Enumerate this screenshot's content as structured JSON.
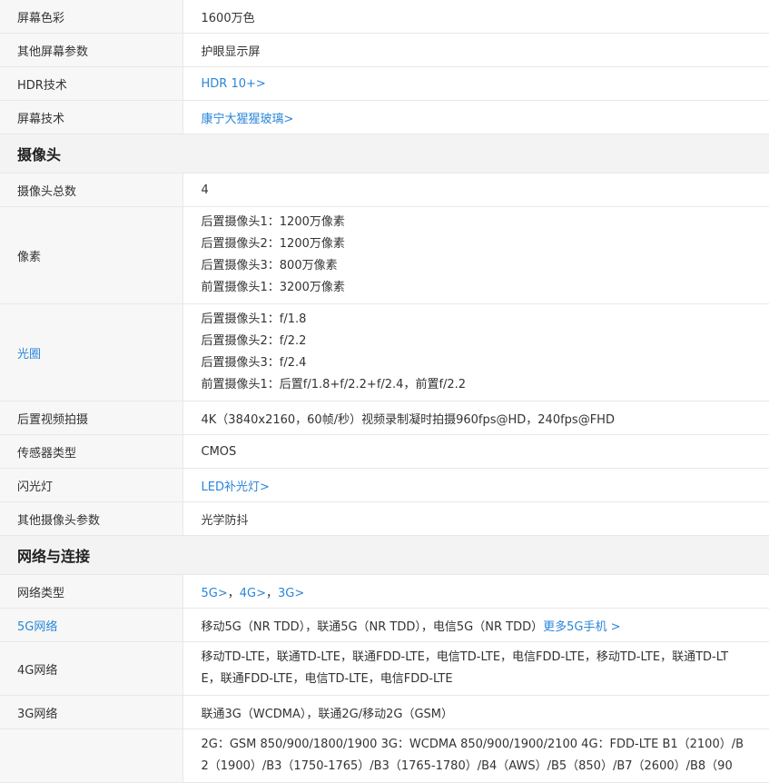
{
  "screen_rows": [
    {
      "label": "屏幕色彩",
      "value": "1600万色"
    },
    {
      "label": "其他屏幕参数",
      "value": "护眼显示屏"
    },
    {
      "label": "HDR技术",
      "value": "HDR 10+>"
    },
    {
      "label": "屏幕技术",
      "value": "康宁大猩猩玻璃>"
    }
  ],
  "camera": {
    "title": "摄像头",
    "total": {
      "label": "摄像头总数",
      "value": "4"
    },
    "pixels": {
      "label": "像素",
      "lines": [
        "后置摄像头1：1200万像素",
        "后置摄像头2：1200万像素",
        "后置摄像头3：800万像素",
        "前置摄像头1：3200万像素"
      ]
    },
    "aperture": {
      "label": "光圈",
      "lines": [
        "后置摄像头1：f/1.8",
        "后置摄像头2：f/2.2",
        "后置摄像头3：f/2.4",
        "前置摄像头1：后置f/1.8+f/2.2+f/2.4，前置f/2.2"
      ]
    },
    "video": {
      "label": "后置视频拍摄",
      "value": "4K（3840x2160，60帧/秒）视频录制凝时拍摄960fps@HD，240fps@FHD"
    },
    "sensor": {
      "label": "传感器类型",
      "value": "CMOS"
    },
    "flash": {
      "label": "闪光灯",
      "value": "LED补光灯>"
    },
    "other": {
      "label": "其他摄像头参数",
      "value": "光学防抖"
    }
  },
  "network": {
    "title": "网络与连接",
    "type": {
      "label": "网络类型",
      "links": [
        "5G>",
        "4G>",
        "3G>"
      ],
      "separator": "，"
    },
    "net5g": {
      "label": "5G网络",
      "value": "移动5G（NR TDD），联通5G（NR TDD），电信5G（NR TDD）",
      "link": "更多5G手机 >"
    },
    "net4g": {
      "label": "4G网络",
      "lines": [
        "移动TD-LTE，联通TD-LTE，联通FDD-LTE，电信TD-LTE，电信FDD-LTE，移动TD-LTE，联通TD-LT",
        "E，联通FDD-LTE，电信TD-LTE，电信FDD-LTE"
      ]
    },
    "net3g": {
      "label": "3G网络",
      "value": "联通3G（WCDMA），联通2G/移动2G（GSM）"
    },
    "bands": {
      "label": "",
      "lines": [
        "2G：GSM 850/900/1800/1900 3G：WCDMA 850/900/1900/2100 4G：FDD-LTE B1（2100）/B",
        "2（1900）/B3（1750-1765）/B3（1765-1780）/B4（AWS）/B5（850）/B7（2600）/B8（90"
      ]
    }
  },
  "colors": {
    "link": "#2a86d8",
    "key_bg": "#f7f7f7",
    "section_bg": "#f3f3f3",
    "border": "#e8e8e8"
  }
}
